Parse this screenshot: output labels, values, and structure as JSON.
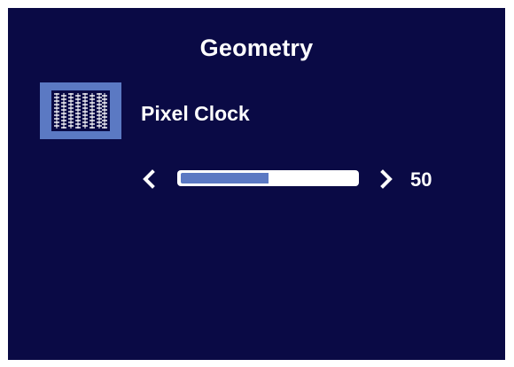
{
  "osd": {
    "title": "Geometry",
    "item": {
      "icon": "pixel-clock-icon",
      "label": "Pixel Clock"
    },
    "slider": {
      "value": "50",
      "level_percent": 50
    }
  },
  "colors": {
    "background": "#0a0a45",
    "accent": "#5b79c3",
    "text": "#ffffff"
  }
}
